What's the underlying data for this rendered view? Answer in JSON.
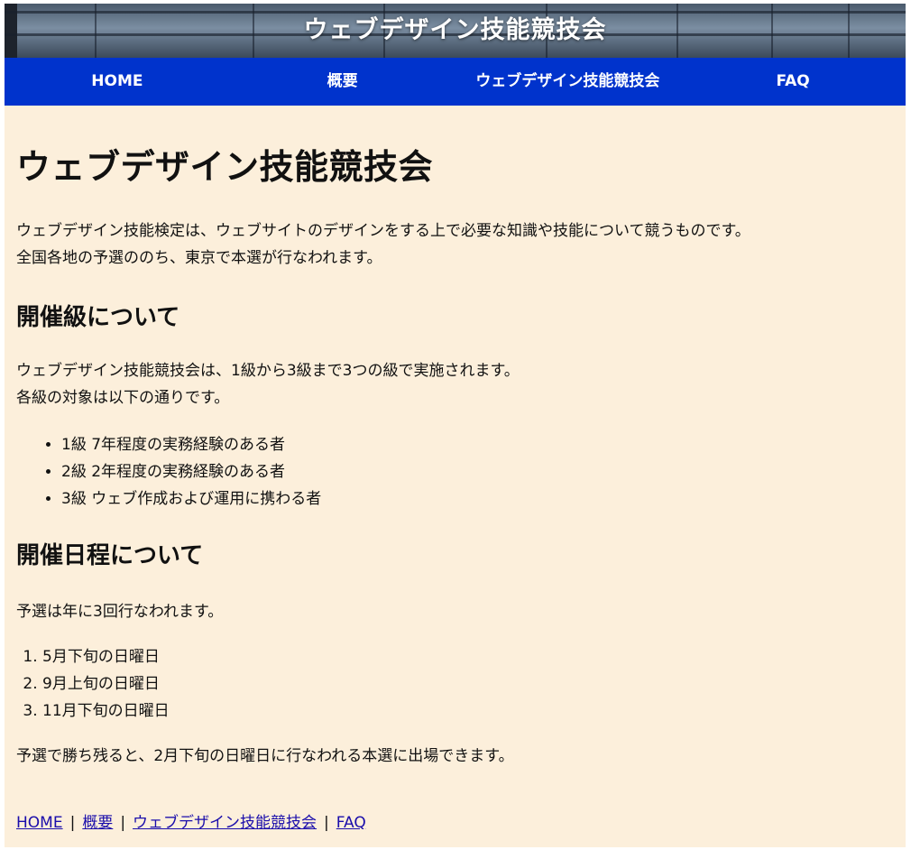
{
  "banner": {
    "title": "ウェブデザイン技能競技会"
  },
  "nav": {
    "items": [
      {
        "label": "HOME"
      },
      {
        "label": "概要"
      },
      {
        "label": "ウェブデザイン技能競技会"
      },
      {
        "label": "FAQ"
      }
    ]
  },
  "main": {
    "title": "ウェブデザイン技能競技会",
    "intro": [
      "ウェブデザイン技能検定は、ウェブサイトのデザインをする上で必要な知識や技能について競うものです。",
      "全国各地の予選ののち、東京で本選が行なわれます。"
    ],
    "grades": {
      "heading": "開催級について",
      "text": [
        "ウェブデザイン技能競技会は、1級から3級まで3つの級で実施されます。",
        "各級の対象は以下の通りです。"
      ],
      "items": [
        "1級 7年程度の実務経験のある者",
        "2級 2年程度の実務経験のある者",
        "3級 ウェブ作成および運用に携わる者"
      ]
    },
    "schedule": {
      "heading": "開催日程について",
      "text": "予選は年に3回行なわれます。",
      "items": [
        "5月下旬の日曜日",
        "9月上旬の日曜日",
        "11月下旬の日曜日"
      ],
      "note": "予選で勝ち残ると、2月下旬の日曜日に行なわれる本選に出場できます。"
    }
  },
  "footer": {
    "links": [
      {
        "label": "HOME"
      },
      {
        "label": "概要"
      },
      {
        "label": "ウェブデザイン技能競技会"
      },
      {
        "label": "FAQ"
      }
    ],
    "separator": "|"
  }
}
